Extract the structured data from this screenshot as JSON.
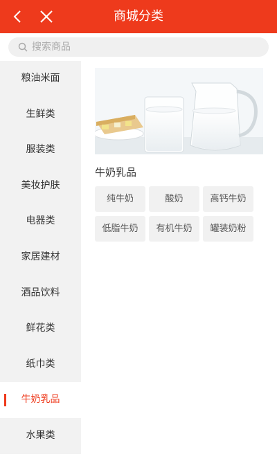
{
  "header": {
    "title": "商城分类",
    "back_icon": "chevron-left-icon",
    "close_icon": "close-icon",
    "color": "#ee3a1c"
  },
  "search": {
    "placeholder": "搜索商品",
    "icon": "search-icon"
  },
  "sidebar": {
    "items": [
      {
        "label": "粮油米面"
      },
      {
        "label": "生鲜类"
      },
      {
        "label": "服装类"
      },
      {
        "label": "美妆护肤"
      },
      {
        "label": "电器类"
      },
      {
        "label": "家居建材"
      },
      {
        "label": "酒品饮料"
      },
      {
        "label": "鲜花类"
      },
      {
        "label": "纸巾类"
      },
      {
        "label": "牛奶乳品",
        "active": true
      },
      {
        "label": "水果类"
      }
    ],
    "active_color": "#ee3a1c"
  },
  "main": {
    "subcategory_title": "牛奶乳品",
    "tags": [
      {
        "label": "纯牛奶"
      },
      {
        "label": "酸奶"
      },
      {
        "label": "高钙牛奶"
      },
      {
        "label": "低脂牛奶"
      },
      {
        "label": "有机牛奶"
      },
      {
        "label": "罐装奶粉"
      }
    ]
  }
}
